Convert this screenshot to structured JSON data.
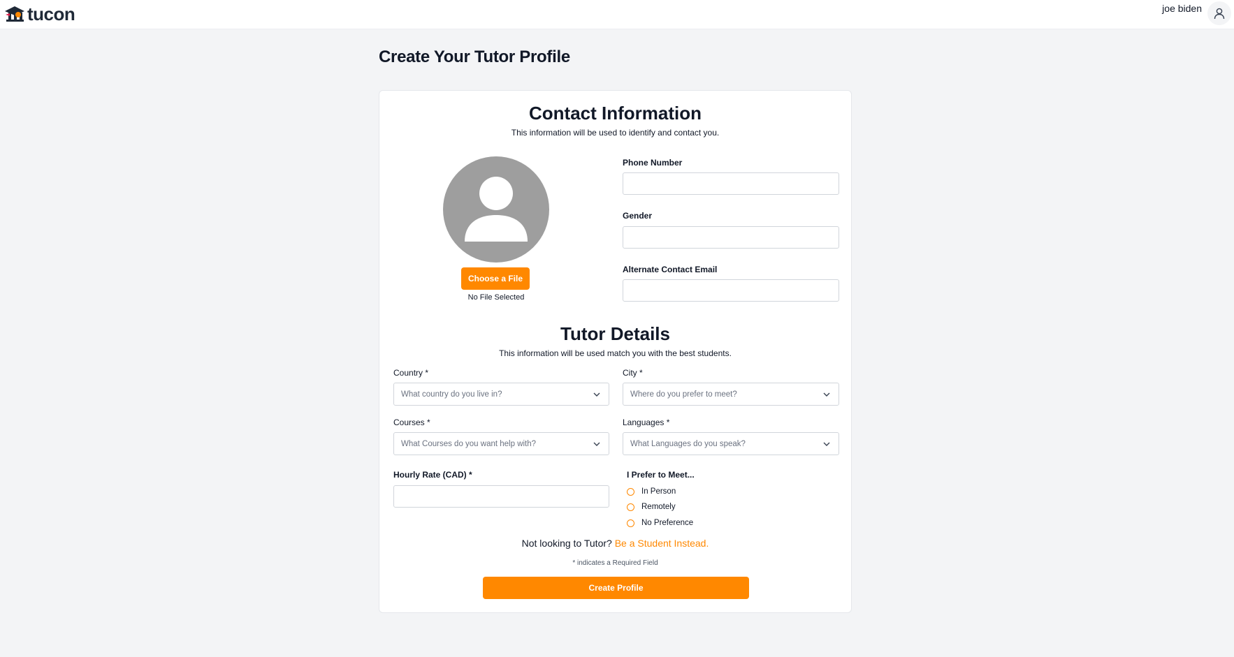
{
  "brand": {
    "name": "tucon",
    "accent": "#ff8800"
  },
  "header": {
    "user_name": "joe biden",
    "user_icon": "user-icon"
  },
  "page": {
    "title": "Create Your Tutor Profile"
  },
  "contact": {
    "title": "Contact Information",
    "subtitle": "This information will be used to identify and contact you.",
    "choose_file_label": "Choose a File",
    "file_status": "No File Selected",
    "phone_label": "Phone Number",
    "phone_value": "",
    "gender_label": "Gender",
    "gender_value": "",
    "alt_email_label": "Alternate Contact Email",
    "alt_email_value": ""
  },
  "tutor": {
    "title": "Tutor Details",
    "subtitle": "This information will be used match you with the best students.",
    "country_label": "Country *",
    "country_placeholder": "What country do you live in?",
    "city_label": "City *",
    "city_placeholder": "Where do you prefer to meet?",
    "courses_label": "Courses *",
    "courses_placeholder": "What Courses do you want help with?",
    "languages_label": "Languages *",
    "languages_placeholder": "What Languages do you speak?",
    "rate_label": "Hourly Rate (CAD) *",
    "rate_value": "",
    "meet_label": "I Prefer to Meet...",
    "meet_options": [
      "In Person",
      "Remotely",
      "No Preference"
    ]
  },
  "footer": {
    "switch_text": "Not looking to Tutor?",
    "switch_link": "Be a Student Instead.",
    "required_note": "* indicates a Required Field",
    "create_label": "Create Profile"
  }
}
